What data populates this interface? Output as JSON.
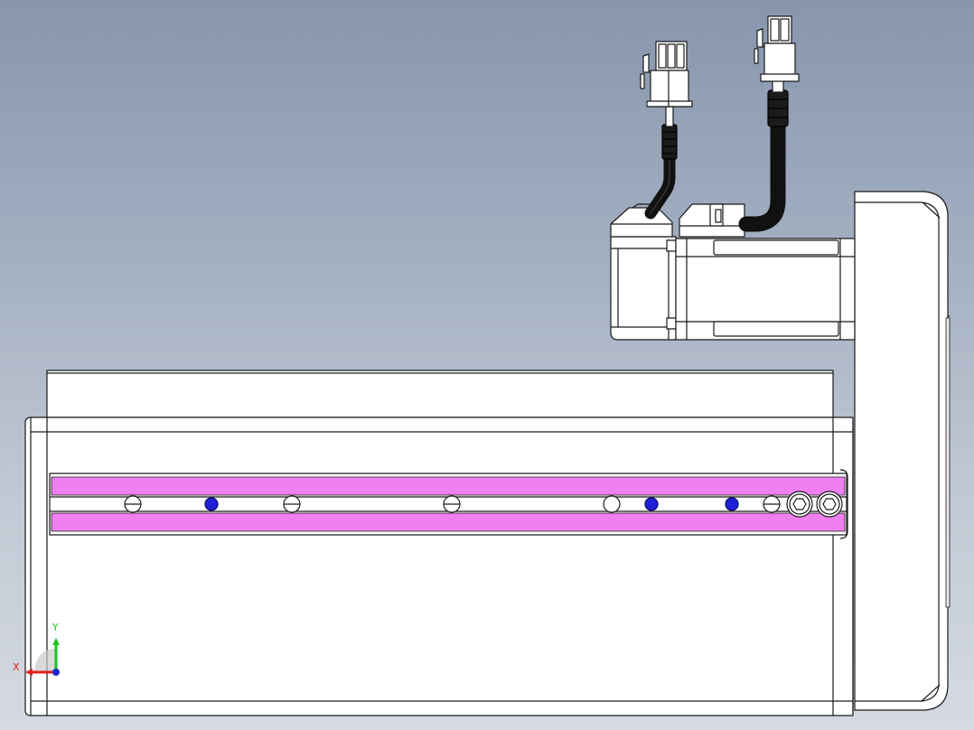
{
  "triad": {
    "x_label": "X",
    "y_label": "Y",
    "x_color": "#e0201c",
    "y_color": "#19c21c",
    "z_color": "#1a2bd0"
  },
  "colors": {
    "background_top": "#8796ad",
    "background_bottom": "#d5dae2",
    "slot_stripe": "#f07ff0",
    "blue_marker": "#1f1fd8",
    "cable": "#111111",
    "body_fill": "#ffffff",
    "edge": "#1a1a1a"
  },
  "icons": {
    "connector": "connector-icon",
    "cable": "cable-icon",
    "hex_screw": "hex-socket-screw-icon",
    "slotted_screw": "slotted-screw-icon",
    "triad": "coordinate-triad-icon"
  }
}
